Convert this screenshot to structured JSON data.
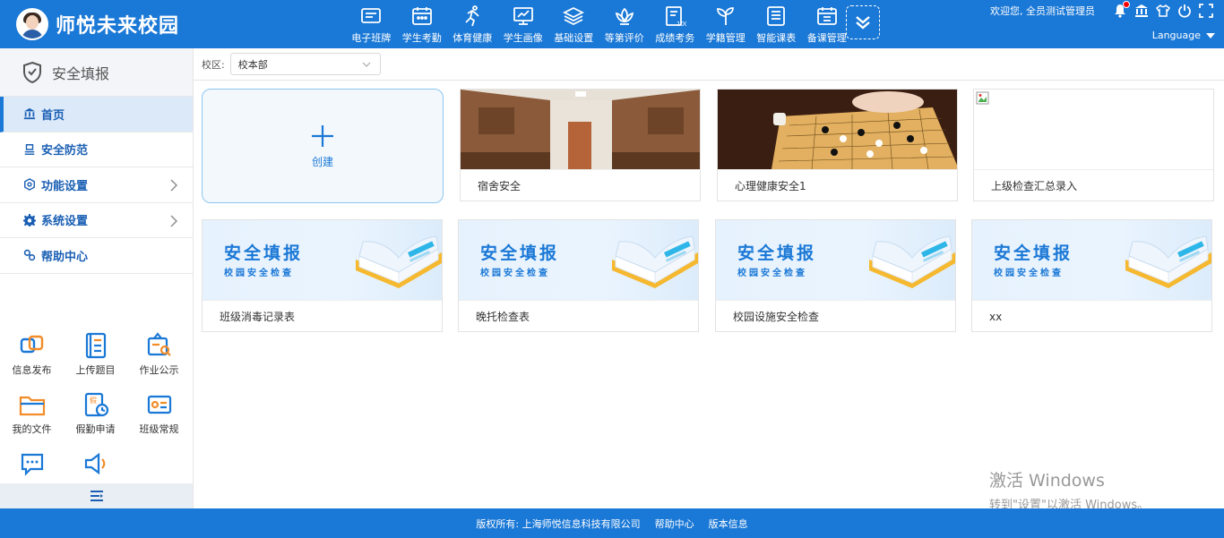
{
  "app": {
    "title": "师悦未来校园"
  },
  "nav": {
    "items": [
      {
        "label": "电子班牌",
        "icon": "display-board-icon"
      },
      {
        "label": "学生考勤",
        "icon": "calendar-icon"
      },
      {
        "label": "体育健康",
        "icon": "running-icon"
      },
      {
        "label": "学生画像",
        "icon": "monitor-chart-icon"
      },
      {
        "label": "基础设置",
        "icon": "layers-icon"
      },
      {
        "label": "等第评价",
        "icon": "lotus-icon"
      },
      {
        "label": "成绩考务",
        "icon": "score-sheet-icon"
      },
      {
        "label": "学籍管理",
        "icon": "sprout-icon"
      },
      {
        "label": "智能课表",
        "icon": "list-icon"
      },
      {
        "label": "备课管理",
        "icon": "calendar-grid-icon"
      }
    ],
    "more_icon": "double-chevron-down-icon"
  },
  "header": {
    "welcome": "欢迎您, 全员测试管理员",
    "language": "Language"
  },
  "sidebar": {
    "title": "安全填报",
    "items": [
      {
        "label": "首页",
        "icon": "bank-icon",
        "active": true
      },
      {
        "label": "安全防范",
        "icon": "shield-stack-icon"
      },
      {
        "label": "功能设置",
        "icon": "settings-icon",
        "expandable": true
      },
      {
        "label": "系统设置",
        "icon": "gear-icon",
        "expandable": true
      },
      {
        "label": "帮助中心",
        "icon": "link-icon"
      }
    ],
    "quick": [
      {
        "label": "信息发布",
        "icon": "overlap-squares-icon"
      },
      {
        "label": "上传题目",
        "icon": "notebook-icon"
      },
      {
        "label": "作业公示",
        "icon": "search-board-icon"
      },
      {
        "label": "我的文件",
        "icon": "folder-icon"
      },
      {
        "label": "假勤申请",
        "icon": "leave-calendar-icon"
      },
      {
        "label": "班级常规",
        "icon": "class-card-icon"
      },
      {
        "label": "",
        "icon": "chat-bubble-icon"
      },
      {
        "label": "",
        "icon": "speaker-icon"
      }
    ]
  },
  "filter": {
    "campus_label": "校区:",
    "campus_value": "校本部"
  },
  "create_label": "创建",
  "cards": [
    {
      "label": "宿舍安全",
      "image": "dormitory-photo"
    },
    {
      "label": "心理健康安全1",
      "image": "go-board-photo"
    },
    {
      "label": "上级检查汇总录入",
      "image": "broken-image"
    },
    {
      "label": "班级消毒记录表",
      "image": "banner"
    },
    {
      "label": "晚托检查表",
      "image": "banner"
    },
    {
      "label": "校园设施安全检查",
      "image": "banner"
    },
    {
      "label": "xx",
      "image": "banner"
    }
  ],
  "banner": {
    "title": "安全填报",
    "subtitle": "校园安全检查"
  },
  "watermark": {
    "line1": "激活 Windows",
    "line2": "转到\"设置\"以激活 Windows。"
  },
  "footer": {
    "copyright": "版权所有: 上海师悦信息科技有限公司",
    "help": "帮助中心",
    "version": "版本信息"
  }
}
